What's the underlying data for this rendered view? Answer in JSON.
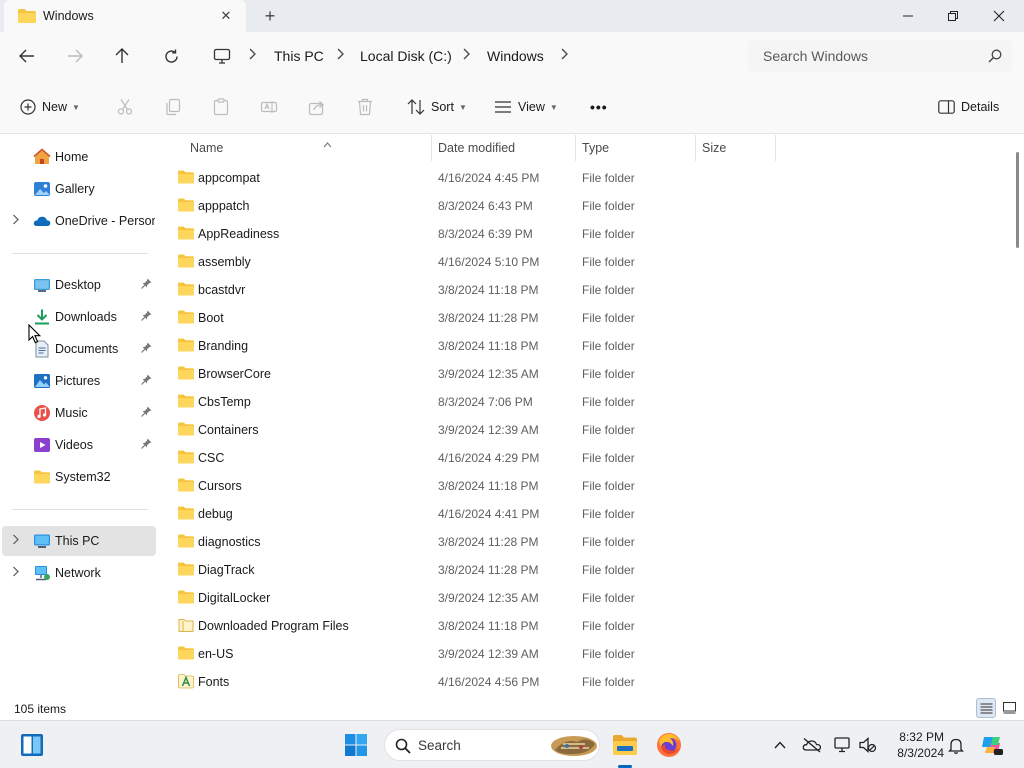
{
  "window": {
    "tab_title": "Windows",
    "tab_close_symbol": "✕",
    "new_tab_symbol": "+"
  },
  "address": {
    "crumbs": [
      "This PC",
      "Local Disk (C:)",
      "Windows"
    ],
    "search_placeholder": "Search Windows"
  },
  "toolbar": {
    "new_label": "New",
    "sort_label": "Sort",
    "view_label": "View",
    "more_label": "•••",
    "details_label": "Details"
  },
  "sidebar": {
    "items": [
      {
        "label": "Home",
        "icon": "home-icon"
      },
      {
        "label": "Gallery",
        "icon": "gallery-icon"
      },
      {
        "label": "OneDrive - Personal",
        "icon": "onedrive-icon",
        "expandable": true
      },
      {
        "label": "Desktop",
        "icon": "desktop-icon",
        "pinned": true
      },
      {
        "label": "Downloads",
        "icon": "downloads-icon",
        "pinned": true
      },
      {
        "label": "Documents",
        "icon": "documents-icon",
        "pinned": true
      },
      {
        "label": "Pictures",
        "icon": "pictures-icon",
        "pinned": true
      },
      {
        "label": "Music",
        "icon": "music-icon",
        "pinned": true
      },
      {
        "label": "Videos",
        "icon": "videos-icon",
        "pinned": true
      },
      {
        "label": "System32",
        "icon": "folder-icon"
      },
      {
        "label": "This PC",
        "icon": "this-pc-icon",
        "expandable": true,
        "selected": true
      },
      {
        "label": "Network",
        "icon": "network-icon",
        "expandable": true
      }
    ]
  },
  "columns": {
    "name": "Name",
    "date": "Date modified",
    "type": "Type",
    "size": "Size"
  },
  "files": [
    {
      "name": "appcompat",
      "date": "4/16/2024 4:45 PM",
      "type": "File folder"
    },
    {
      "name": "apppatch",
      "date": "8/3/2024 6:43 PM",
      "type": "File folder"
    },
    {
      "name": "AppReadiness",
      "date": "8/3/2024 6:39 PM",
      "type": "File folder"
    },
    {
      "name": "assembly",
      "date": "4/16/2024 5:10 PM",
      "type": "File folder"
    },
    {
      "name": "bcastdvr",
      "date": "3/8/2024 11:18 PM",
      "type": "File folder"
    },
    {
      "name": "Boot",
      "date": "3/8/2024 11:28 PM",
      "type": "File folder"
    },
    {
      "name": "Branding",
      "date": "3/8/2024 11:18 PM",
      "type": "File folder"
    },
    {
      "name": "BrowserCore",
      "date": "3/9/2024 12:35 AM",
      "type": "File folder"
    },
    {
      "name": "CbsTemp",
      "date": "8/3/2024 7:06 PM",
      "type": "File folder"
    },
    {
      "name": "Containers",
      "date": "3/9/2024 12:39 AM",
      "type": "File folder"
    },
    {
      "name": "CSC",
      "date": "4/16/2024 4:29 PM",
      "type": "File folder"
    },
    {
      "name": "Cursors",
      "date": "3/8/2024 11:18 PM",
      "type": "File folder"
    },
    {
      "name": "debug",
      "date": "4/16/2024 4:41 PM",
      "type": "File folder"
    },
    {
      "name": "diagnostics",
      "date": "3/8/2024 11:28 PM",
      "type": "File folder"
    },
    {
      "name": "DiagTrack",
      "date": "3/8/2024 11:28 PM",
      "type": "File folder"
    },
    {
      "name": "DigitalLocker",
      "date": "3/9/2024 12:35 AM",
      "type": "File folder"
    },
    {
      "name": "Downloaded Program Files",
      "date": "3/8/2024 11:18 PM",
      "type": "File folder",
      "icon": "special-folder-icon"
    },
    {
      "name": "en-US",
      "date": "3/9/2024 12:39 AM",
      "type": "File folder"
    },
    {
      "name": "Fonts",
      "date": "4/16/2024 4:56 PM",
      "type": "File folder",
      "icon": "fonts-folder-icon"
    }
  ],
  "status": {
    "item_count": "105 items"
  },
  "taskbar": {
    "search_label": "Search",
    "time": "8:32 PM",
    "date": "8/3/2024"
  },
  "colors": {
    "folder": "#f5c542",
    "accent": "#0067c0",
    "selected_bg": "#e3e3e3"
  }
}
